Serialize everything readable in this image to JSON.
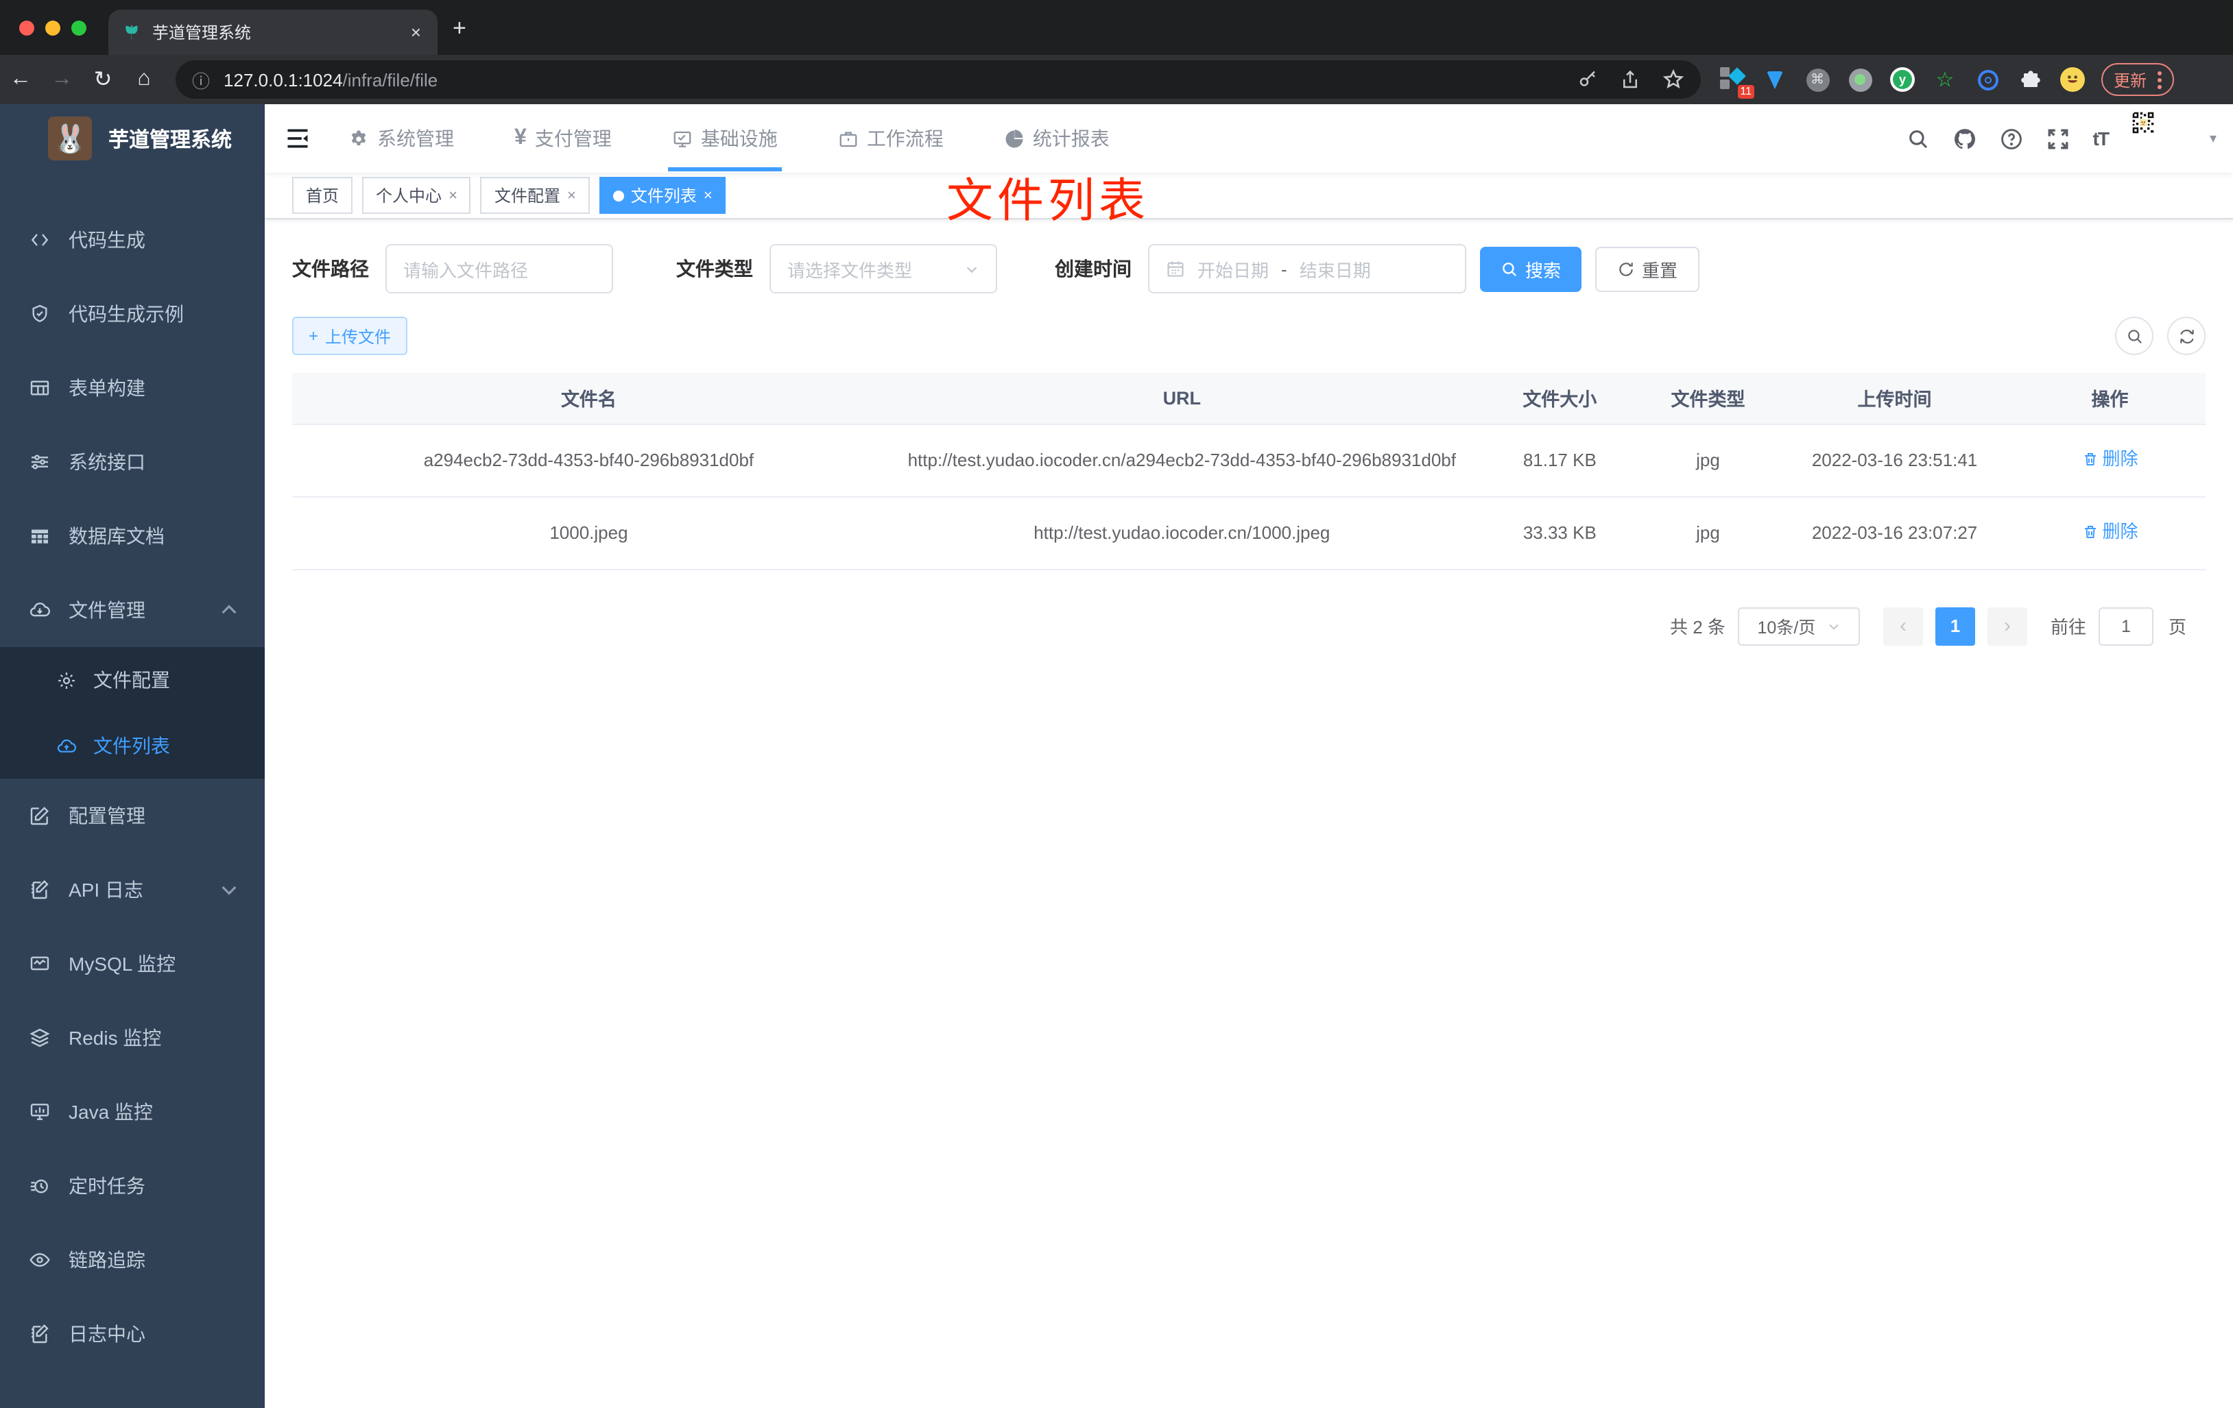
{
  "browser": {
    "tab_title": "芋道管理系统",
    "url_host": "127.0.0.1:1024",
    "url_path": "/infra/file/file",
    "ext_badge": "11",
    "update_label": "更新"
  },
  "glyphs": {
    "back": "←",
    "forward": "→",
    "reload": "↻",
    "home": "⌂",
    "info": "ⓘ",
    "newtab": "+",
    "close": "×",
    "yen": "¥",
    "font_size": "tT",
    "caret_down": "▾",
    "prev": "‹",
    "next": "›",
    "dash": "-",
    "plus": "+",
    "cmd": "⌘",
    "star": "☆"
  },
  "header": {
    "menus": [
      {
        "label": "系统管理"
      },
      {
        "label": "支付管理"
      },
      {
        "label": "基础设施"
      },
      {
        "label": "工作流程"
      },
      {
        "label": "统计报表"
      }
    ]
  },
  "sidebar": {
    "title": "芋道管理系统",
    "items": [
      {
        "label": "代码生成"
      },
      {
        "label": "代码生成示例"
      },
      {
        "label": "表单构建"
      },
      {
        "label": "系统接口"
      },
      {
        "label": "数据库文档"
      },
      {
        "label": "文件管理"
      },
      {
        "label": "配置管理"
      },
      {
        "label": "API 日志"
      },
      {
        "label": "MySQL 监控"
      },
      {
        "label": "Redis 监控"
      },
      {
        "label": "Java 监控"
      },
      {
        "label": "定时任务"
      },
      {
        "label": "链路追踪"
      },
      {
        "label": "日志中心"
      }
    ],
    "sub_items": [
      {
        "label": "文件配置"
      },
      {
        "label": "文件列表"
      }
    ]
  },
  "tags": [
    {
      "label": "首页"
    },
    {
      "label": "个人中心"
    },
    {
      "label": "文件配置"
    },
    {
      "label": "文件列表"
    }
  ],
  "annotation": "文件列表",
  "filters": {
    "path_label": "文件路径",
    "path_placeholder": "请输入文件路径",
    "type_label": "文件类型",
    "type_placeholder": "请选择文件类型",
    "date_label": "创建时间",
    "date_start": "开始日期",
    "date_end": "结束日期",
    "search_label": "搜索",
    "reset_label": "重置"
  },
  "toolbar": {
    "upload_label": "上传文件"
  },
  "table": {
    "headers": [
      "文件名",
      "URL",
      "文件大小",
      "文件类型",
      "上传时间",
      "操作"
    ],
    "rows": [
      {
        "name": "a294ecb2-73dd-4353-bf40-296b8931d0bf",
        "url": "http://test.yudao.iocoder.cn/a294ecb2-73dd-4353-bf40-296b8931d0bf",
        "size": "81.17 KB",
        "type": "jpg",
        "time": "2022-03-16 23:51:41",
        "action": "删除"
      },
      {
        "name": "1000.jpeg",
        "url": "http://test.yudao.iocoder.cn/1000.jpeg",
        "size": "33.33 KB",
        "type": "jpg",
        "time": "2022-03-16 23:07:27",
        "action": "删除"
      }
    ]
  },
  "pagination": {
    "total": "共 2 条",
    "page_size": "10条/页",
    "current_page": "1",
    "goto_label": "前往",
    "goto_value": "1",
    "page_unit": "页"
  },
  "colors": {
    "accent": "#409eff",
    "sidebar_bg": "#304156",
    "submenu_bg": "#1f2d3d",
    "annotation_red": "#ff2600"
  }
}
